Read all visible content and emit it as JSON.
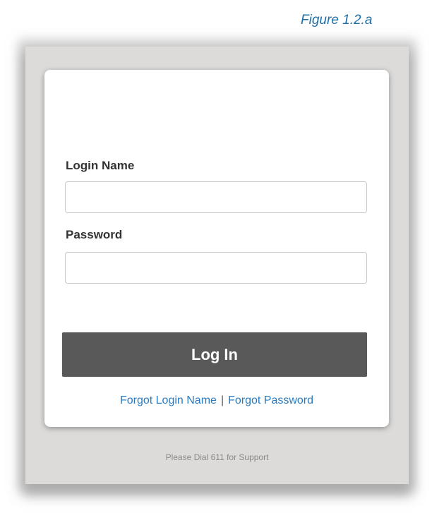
{
  "figure_caption": "Figure 1.2.a",
  "login_form": {
    "login_name_label": "Login Name",
    "login_name_value": "",
    "password_label": "Password",
    "password_value": "",
    "submit_label": "Log In",
    "forgot_login_link": "Forgot Login Name",
    "link_separator": "|",
    "forgot_password_link": "Forgot Password"
  },
  "footer": {
    "support_text": "Please Dial 611 for Support"
  },
  "colors": {
    "button_bg": "#595959",
    "link": "#2b7bbf",
    "caption": "#1f6fa8",
    "frame_bg": "#dcdbd9"
  }
}
